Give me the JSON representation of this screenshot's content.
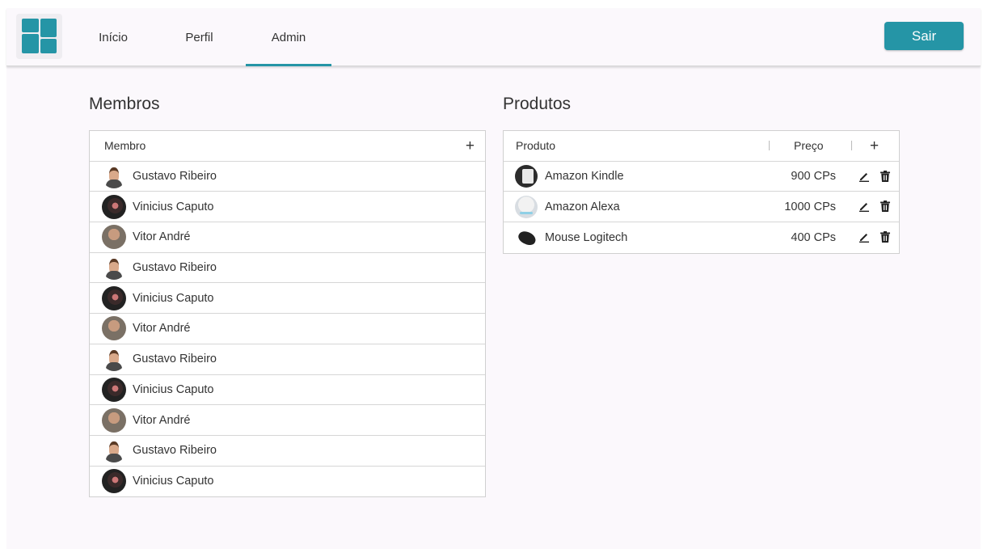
{
  "nav": {
    "tabs": [
      {
        "label": "Início"
      },
      {
        "label": "Perfil"
      },
      {
        "label": "Admin"
      }
    ],
    "logout_label": "Sair"
  },
  "members": {
    "title": "Membros",
    "column_header": "Membro",
    "add_symbol": "+",
    "rows": [
      {
        "name": "Gustavo Ribeiro",
        "avatar": "gustavo"
      },
      {
        "name": "Vinicius Caputo",
        "avatar": "vinicius"
      },
      {
        "name": "Vitor André",
        "avatar": "vitor"
      },
      {
        "name": "Gustavo Ribeiro",
        "avatar": "gustavo"
      },
      {
        "name": "Vinicius Caputo",
        "avatar": "vinicius"
      },
      {
        "name": "Vitor André",
        "avatar": "vitor"
      },
      {
        "name": "Gustavo Ribeiro",
        "avatar": "gustavo"
      },
      {
        "name": "Vinicius Caputo",
        "avatar": "vinicius"
      },
      {
        "name": "Vitor André",
        "avatar": "vitor"
      },
      {
        "name": "Gustavo Ribeiro",
        "avatar": "gustavo"
      },
      {
        "name": "Vinicius Caputo",
        "avatar": "vinicius"
      }
    ]
  },
  "products": {
    "title": "Produtos",
    "col_product": "Produto",
    "col_price": "Preço",
    "add_symbol": "+",
    "rows": [
      {
        "name": "Amazon Kindle",
        "price": "900 CPs",
        "icon": "kindle"
      },
      {
        "name": "Amazon Alexa",
        "price": "1000 CPs",
        "icon": "alexa"
      },
      {
        "name": "Mouse Logitech",
        "price": "400 CPs",
        "icon": "mouse"
      }
    ]
  },
  "colors": {
    "accent": "#2595a6",
    "background": "#fbf8fc"
  },
  "icons": {
    "edit": "pencil-icon",
    "delete": "trash-icon",
    "add": "plus-icon"
  }
}
